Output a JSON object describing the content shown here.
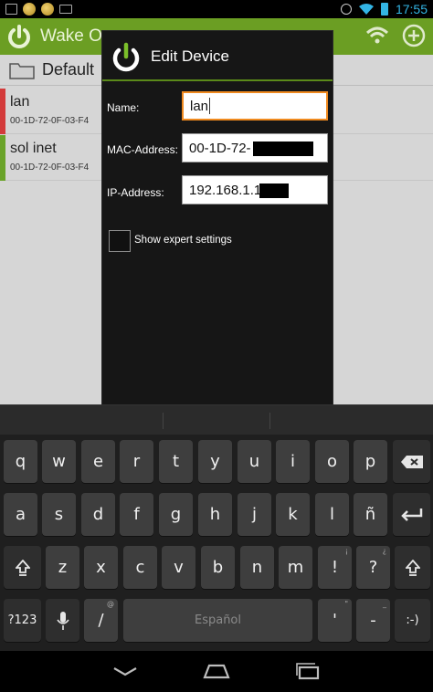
{
  "status_bar": {
    "time": "17:55",
    "icons": [
      "image-icon",
      "coin-icon",
      "coin-icon",
      "keyboard-icon",
      "alarm-icon",
      "wifi-icon",
      "battery-icon"
    ]
  },
  "app_bar": {
    "title": "Wake On",
    "icons": [
      "power-logo-icon",
      "wifi-icon",
      "add-icon"
    ]
  },
  "list": {
    "folder": "Default",
    "devices": [
      {
        "name": "lan",
        "mac": "00-1D-72-0F-03-F4",
        "status_color": "#d33b3b"
      },
      {
        "name": "sol inet",
        "mac": "00-1D-72-0F-03-F4",
        "status_color": "#6aa329"
      }
    ]
  },
  "dialog": {
    "title": "Edit Device",
    "name_label": "Name:",
    "name_value": "lan",
    "mac_label": "MAC-Address:",
    "mac_value": "00-1D-72-",
    "ip_label": "IP-Address:",
    "ip_value": "192.168.1.1",
    "expert_label": "Show expert settings",
    "expert_checked": false
  },
  "keyboard": {
    "row1": [
      "q",
      "w",
      "e",
      "r",
      "t",
      "y",
      "u",
      "i",
      "o",
      "p"
    ],
    "row2": [
      "a",
      "s",
      "d",
      "f",
      "g",
      "h",
      "j",
      "k",
      "l",
      "ñ"
    ],
    "row3": [
      "z",
      "x",
      "c",
      "v",
      "b",
      "n",
      "m",
      "!",
      "?"
    ],
    "row3_sup": [
      "",
      "",
      "",
      "",
      "",
      "",
      "",
      "¡",
      "¿"
    ],
    "symbols_key": "?123",
    "slash_key": "/",
    "slash_sup": "@",
    "space_label": "Español",
    "quote_key": "'",
    "quote_sup": "\"",
    "dash_key": "-",
    "dash_sup": "_",
    "smile_key": ":-)",
    "colors": {
      "accent": "#6b9e23",
      "focus": "#f08a1f",
      "clock": "#33b5e5"
    }
  }
}
